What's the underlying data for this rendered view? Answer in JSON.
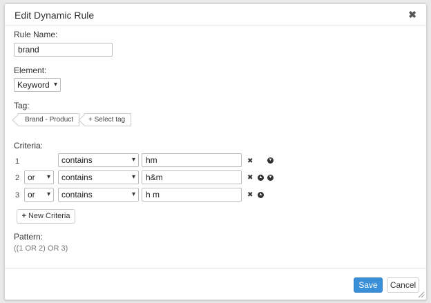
{
  "dialog": {
    "title": "Edit Dynamic Rule",
    "close_glyph": "✖"
  },
  "form": {
    "rule_name_label": "Rule Name:",
    "rule_name_value": "brand",
    "element_label": "Element:",
    "element_value": "Keyword",
    "tag_label": "Tag:",
    "tags": [
      "Brand - Product"
    ],
    "select_tag_label": "Select tag",
    "criteria_label": "Criteria:",
    "criteria": [
      {
        "num": "1",
        "logic": "",
        "operator": "contains",
        "value": "hm"
      },
      {
        "num": "2",
        "logic": "or",
        "operator": "contains",
        "value": "h&m"
      },
      {
        "num": "3",
        "logic": "or",
        "operator": "contains",
        "value": "h m"
      }
    ],
    "new_criteria_label": "New Criteria",
    "pattern_label": "Pattern:",
    "pattern_value": "((1 OR 2) OR 3)"
  },
  "footer": {
    "save_label": "Save",
    "cancel_label": "Cancel"
  },
  "colors": {
    "accent": "#3a8fd9"
  },
  "icons": {
    "close": "close-icon",
    "remove": "remove-icon",
    "move_up": "arrow-up-circle-icon",
    "move_down": "arrow-down-circle-icon",
    "plus": "plus-icon",
    "chevron": "chevron-down-icon"
  }
}
